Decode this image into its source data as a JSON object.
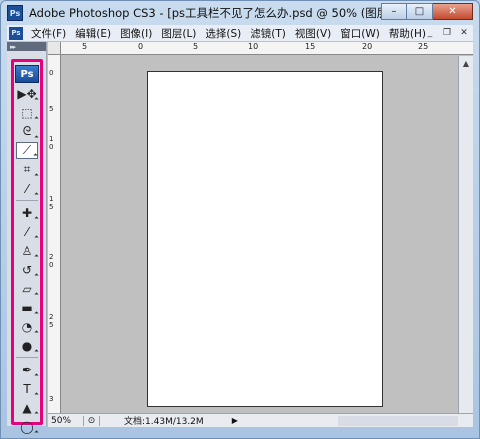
{
  "window": {
    "title": "Adobe Photoshop CS3 - [ps工具栏不见了怎么办.psd @ 50% (图层 3, RGB/8#)]",
    "controls": {
      "minimize": "–",
      "maximize": "□",
      "close": "✕"
    }
  },
  "menubar": {
    "logo": "Ps",
    "items": [
      {
        "label": "文件(F)"
      },
      {
        "label": "编辑(E)"
      },
      {
        "label": "图像(I)"
      },
      {
        "label": "图层(L)"
      },
      {
        "label": "选择(S)"
      },
      {
        "label": "滤镜(T)"
      },
      {
        "label": "视图(V)"
      },
      {
        "label": "窗口(W)"
      },
      {
        "label": "帮助(H)"
      }
    ],
    "doc_controls": {
      "minimize": "_",
      "restore": "❐",
      "close": "✕"
    }
  },
  "toolbar": {
    "grip": "▸▸",
    "logo": "Ps",
    "tools": [
      {
        "name": "move-tool",
        "glyph": "▶✥"
      },
      {
        "name": "marquee-tool",
        "glyph": "⬚"
      },
      {
        "name": "lasso-tool",
        "glyph": "ᘓ"
      },
      {
        "name": "magic-wand-tool",
        "glyph": "⟋"
      },
      {
        "name": "crop-tool",
        "glyph": "⌗"
      },
      {
        "name": "eyedropper-tool",
        "glyph": "⁄"
      },
      {
        "name": "healing-brush-tool",
        "glyph": "✚"
      },
      {
        "name": "brush-tool",
        "glyph": "⁄"
      },
      {
        "name": "clone-stamp-tool",
        "glyph": "♙"
      },
      {
        "name": "history-brush-tool",
        "glyph": "↺"
      },
      {
        "name": "eraser-tool",
        "glyph": "▱"
      },
      {
        "name": "gradient-tool",
        "glyph": "▬"
      },
      {
        "name": "blur-tool",
        "glyph": "◔"
      },
      {
        "name": "dodge-tool",
        "glyph": "●"
      },
      {
        "name": "pen-tool",
        "glyph": "✒"
      },
      {
        "name": "type-tool",
        "glyph": "T"
      },
      {
        "name": "path-selection-tool",
        "glyph": "▲"
      },
      {
        "name": "ellipse-tool",
        "glyph": "◯"
      }
    ],
    "active_tool": "magic-wand-tool"
  },
  "rulers": {
    "top_labels": [
      "5",
      "0",
      "5",
      "10",
      "15",
      "20",
      "25"
    ],
    "left_labels": [
      "0",
      "5",
      "1",
      "0",
      "1",
      "5",
      "2",
      "0",
      "2",
      "5",
      "3"
    ]
  },
  "statusbar": {
    "zoom": "50%",
    "doc_info": "文档:1.43M/13.2M"
  },
  "colors": {
    "highlight": "#e5007e",
    "workspace": "#c0c0c0",
    "paper": "#ffffff"
  }
}
